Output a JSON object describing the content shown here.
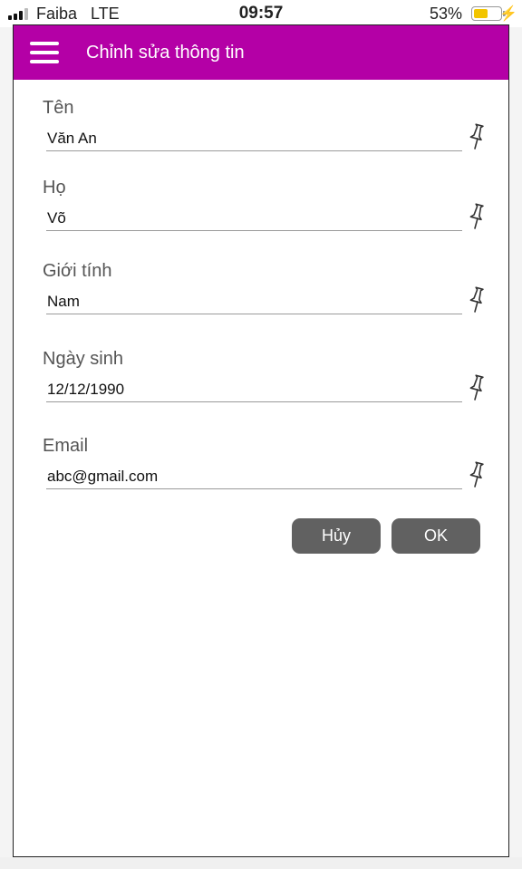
{
  "status_bar": {
    "carrier": "Faiba",
    "network": "LTE",
    "time": "09:57",
    "battery_percent": "53%",
    "battery_level": 0.53,
    "battery_color": "#f2c500"
  },
  "app_bar": {
    "title": "Chỉnh sửa thông tin",
    "menu_icon": "hamburger-menu-icon",
    "color": "#b400a6"
  },
  "form": {
    "fields": [
      {
        "label": "Tên",
        "value": "Văn An",
        "icon": "pin-icon"
      },
      {
        "label": "Họ",
        "value": "Võ",
        "icon": "pin-icon"
      },
      {
        "label": "Giới tính",
        "value": "Nam",
        "icon": "pin-icon"
      },
      {
        "label": "Ngày sinh",
        "value": "12/12/1990",
        "icon": "pin-icon"
      },
      {
        "label": "Email",
        "value": "abc@gmail.com",
        "icon": "pin-icon"
      }
    ],
    "cancel_label": "Hủy",
    "ok_label": "OK",
    "button_color": "#616161"
  }
}
